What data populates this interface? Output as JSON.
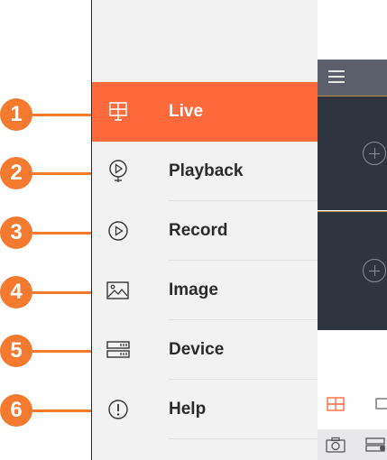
{
  "menu": {
    "items": [
      {
        "label": "Live",
        "icon": "live-grid-icon",
        "active": true,
        "badge": "1"
      },
      {
        "label": "Playback",
        "icon": "playback-icon",
        "active": false,
        "badge": "2"
      },
      {
        "label": "Record",
        "icon": "record-icon",
        "active": false,
        "badge": "3"
      },
      {
        "label": "Image",
        "icon": "image-icon",
        "active": false,
        "badge": "4"
      },
      {
        "label": "Device",
        "icon": "device-icon",
        "active": false,
        "badge": "5"
      },
      {
        "label": "Help",
        "icon": "help-icon",
        "active": false,
        "badge": "6"
      }
    ]
  },
  "colors": {
    "accent": "#ff6a3d",
    "badge": "#f47a30",
    "drawer_bg": "#f2f2f2",
    "video_cell": "#2e3440",
    "topbar": "#5a5f69"
  }
}
